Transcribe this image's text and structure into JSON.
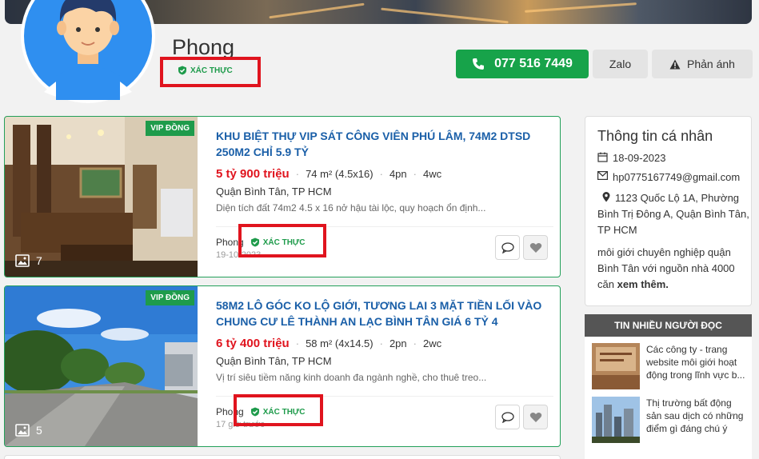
{
  "profile": {
    "name": "Phong",
    "verified_label": "XÁC THỰC",
    "phone_label": "077 516 7449",
    "zalo_label": "Zalo",
    "report_label": "Phản ánh"
  },
  "listings": [
    {
      "badge": "VIP ĐỒNG",
      "photo_count": "7",
      "title": "KHU BIỆT THỰ VIP SÁT CÔNG VIÊN PHÚ LÂM, 74M2 DTSD 250M2 CHỈ 5.9 TỶ",
      "price": "5 tỷ 900 triệu",
      "area": "74 m² (4.5x16)",
      "bedrooms": "4pn",
      "bathrooms": "4wc",
      "location": "Quận Bình Tân,  TP HCM",
      "description": "Diện tích đất 74m2 4.5 x 16 nở hậu tài lộc, quy hoạch ổn định...",
      "poster": "Phong",
      "posted": "19-10-2023"
    },
    {
      "badge": "VIP ĐỒNG",
      "photo_count": "5",
      "title": "58M2 LÔ GÓC KO LỘ GIỚI, TƯƠNG LAI 3 MẶT TIỀN LỐI VÀO CHUNG CƯ LÊ THÀNH AN LẠC BÌNH TÂN GIÁ 6 TỶ 4",
      "price": "6 tỷ 400 triệu",
      "area": "58 m² (4x14.5)",
      "bedrooms": "2pn",
      "bathrooms": "2wc",
      "location": "Quận Bình Tân,  TP HCM",
      "description": "Vị trí siêu tiềm năng kinh doanh đa ngành nghề, cho thuê treo...",
      "poster": "Phong",
      "posted": "17 giờ trước"
    }
  ],
  "sidebar": {
    "title": "Thông tin cá nhân",
    "date": "18-09-2023",
    "email": "hp0775167749@gmail.com",
    "address": "1123 Quốc Lộ 1A, Phường Bình Trị Đông A, Quận Bình Tân, TP HCM",
    "bio": "môi giới chuyên nghiệp quận Bình Tân với nguồn nhà 4000 căn",
    "more_label": "xem thêm.",
    "popular_title": "TIN NHIỀU NGƯỜI ĐỌC",
    "popular": [
      {
        "text": "Các công ty - trang website môi giới hoạt động trong lĩnh vực b..."
      },
      {
        "text": "Thị trường bất động sản sau dịch có những điểm gì đáng chú ý"
      }
    ]
  },
  "colors": {
    "green": "#17a34a",
    "price_red": "#e0141e",
    "title_blue": "#1a5fa8",
    "highlight_red": "#e0141e"
  }
}
